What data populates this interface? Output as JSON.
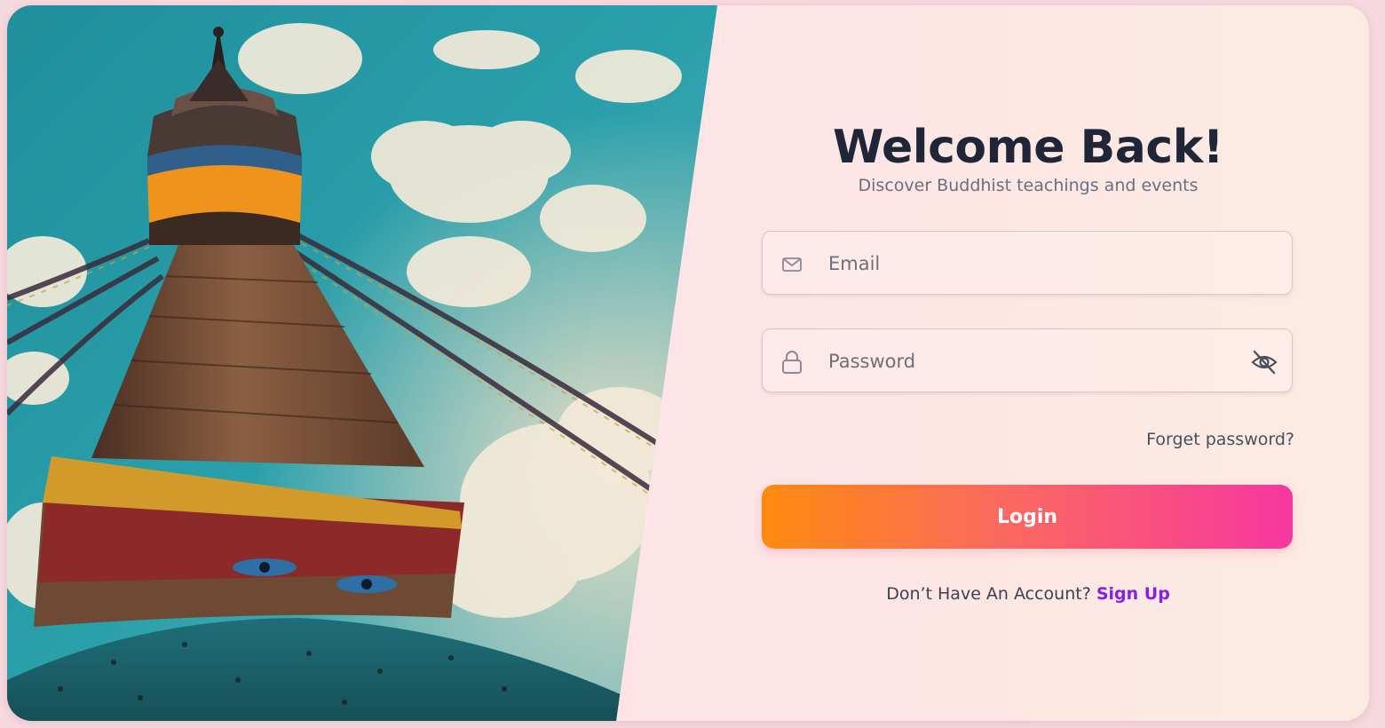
{
  "login": {
    "title": "Welcome Back!",
    "subtitle": "Discover Buddhist teachings and events",
    "email": {
      "placeholder": "Email",
      "value": "",
      "icon": "mail-icon"
    },
    "password": {
      "placeholder": "Password",
      "value": "",
      "icon": "lock-icon",
      "toggle_icon": "eye-off-icon"
    },
    "forgot_label": "Forget password?",
    "login_label": "Login",
    "signup_prompt": "Don’t Have An Account?",
    "signup_label": "Sign Up"
  },
  "colors": {
    "button_gradient_start": "#ff8a0f",
    "button_gradient_end": "#f7379f",
    "link": "#8a1ee0",
    "title": "#1f2638"
  },
  "image": {
    "subject": "stupa-with-prayer-flags"
  }
}
